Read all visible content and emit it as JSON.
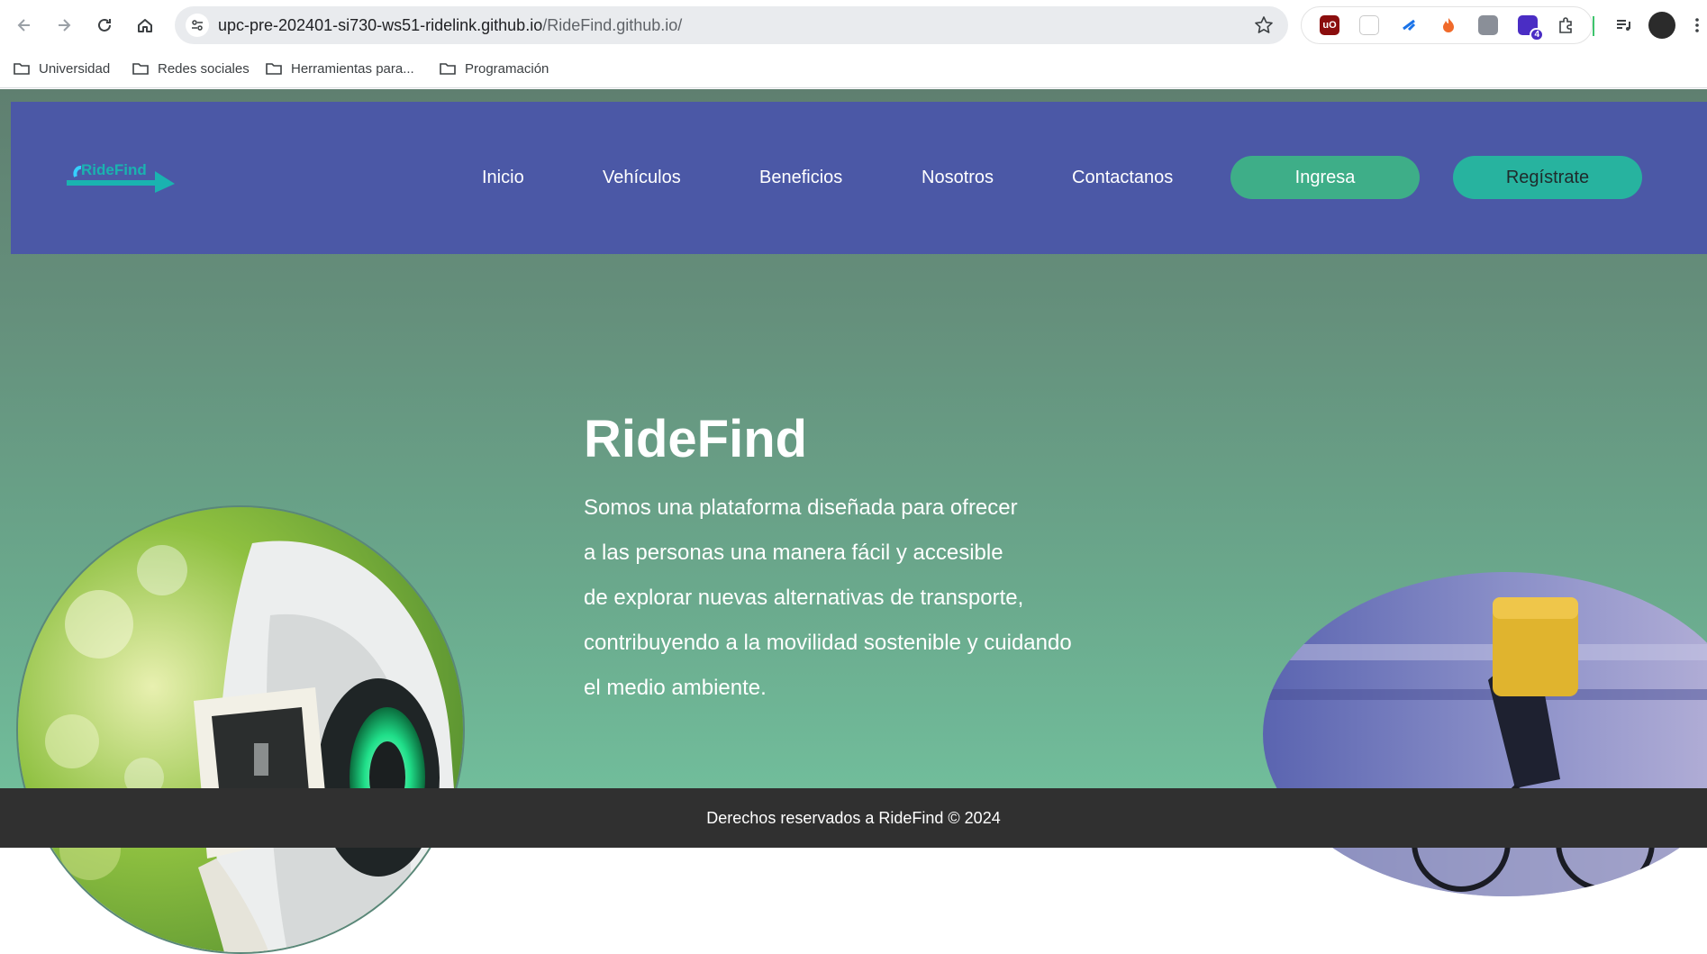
{
  "browser": {
    "url_host": "upc-pre-202401-si730-ws51-ridelink.github.io",
    "url_path": "/RideFind.github.io/",
    "extension_badge_count": "4",
    "bookmarks": [
      {
        "label": "Universidad"
      },
      {
        "label": "Redes sociales"
      },
      {
        "label": "Herramientas para..."
      },
      {
        "label": "Programación"
      }
    ]
  },
  "header": {
    "logo_text": "RideFind",
    "nav": [
      {
        "label": "Inicio"
      },
      {
        "label": "Vehículos"
      },
      {
        "label": "Beneficios"
      },
      {
        "label": "Nosotros"
      },
      {
        "label": "Contactanos"
      }
    ],
    "login_label": "Ingresa",
    "signup_label": "Regístrate"
  },
  "hero": {
    "title": "RideFind",
    "description_lines": [
      "Somos una plataforma diseñada para ofrecer",
      "a las personas una manera fácil y accesible",
      "de explorar nuevas alternativas de transporte,",
      "contribuyendo a la movilidad sostenible y cuidando",
      "el medio ambiente."
    ]
  },
  "footer": {
    "text": "Derechos reservados a RideFind © 2024"
  },
  "colors": {
    "header_bg": "#4b58a6",
    "login_button": "#3eae88",
    "signup_button": "#27b39f",
    "footer_bg": "#303030"
  }
}
